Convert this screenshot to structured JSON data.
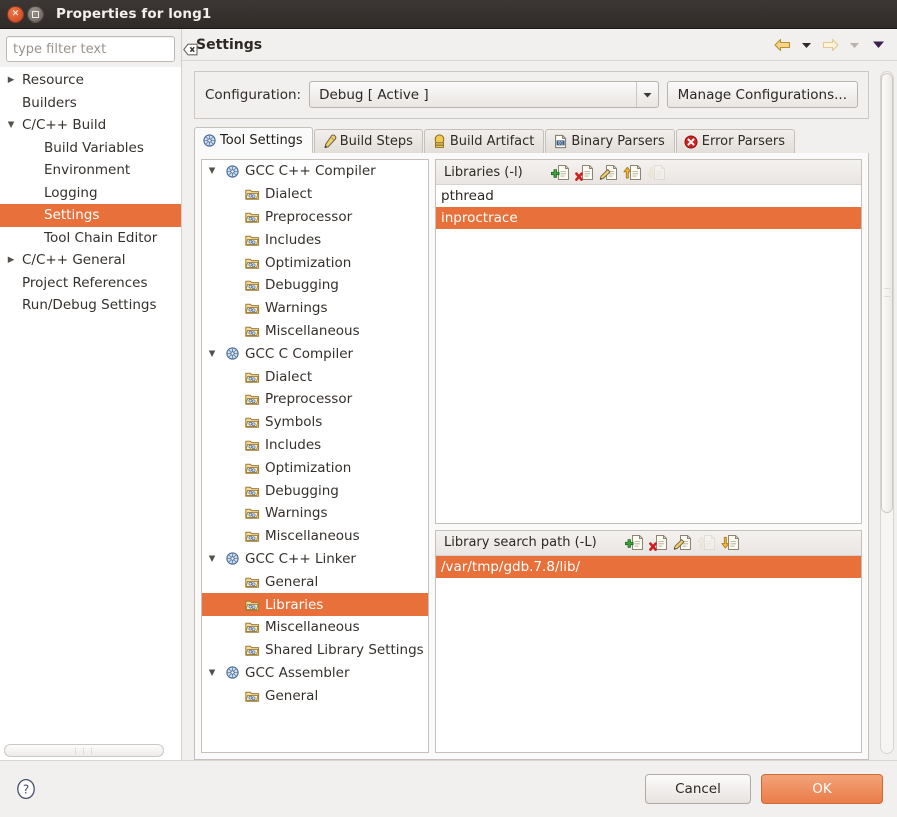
{
  "window": {
    "title": "Properties for long1",
    "close_icon": "close-icon",
    "maximize_icon": "maximize-icon"
  },
  "sidebar": {
    "filter": {
      "placeholder": "type filter text",
      "value": "",
      "clear_icon": "clear-icon"
    },
    "items": [
      {
        "label": "Resource",
        "level": 0,
        "twisty": "collapsed",
        "selected": false
      },
      {
        "label": "Builders",
        "level": 0,
        "twisty": "none",
        "selected": false
      },
      {
        "label": "C/C++ Build",
        "level": 0,
        "twisty": "expanded",
        "selected": false
      },
      {
        "label": "Build Variables",
        "level": 1,
        "twisty": "none",
        "selected": false
      },
      {
        "label": "Environment",
        "level": 1,
        "twisty": "none",
        "selected": false
      },
      {
        "label": "Logging",
        "level": 1,
        "twisty": "none",
        "selected": false
      },
      {
        "label": "Settings",
        "level": 1,
        "twisty": "none",
        "selected": true
      },
      {
        "label": "Tool Chain Editor",
        "level": 1,
        "twisty": "none",
        "selected": false
      },
      {
        "label": "C/C++ General",
        "level": 0,
        "twisty": "collapsed",
        "selected": false
      },
      {
        "label": "Project References",
        "level": 0,
        "twisty": "none",
        "selected": false
      },
      {
        "label": "Run/Debug Settings",
        "level": 0,
        "twisty": "none",
        "selected": false
      }
    ]
  },
  "pane": {
    "title": "Settings",
    "nav": [
      {
        "name": "back-arrow-icon",
        "enabled": true
      },
      {
        "name": "back-dropdown-icon",
        "enabled": true
      },
      {
        "name": "forward-arrow-icon",
        "enabled": false
      },
      {
        "name": "forward-dropdown-icon",
        "enabled": false
      },
      {
        "name": "view-menu-dropdown-icon",
        "enabled": true
      }
    ]
  },
  "configuration": {
    "label": "Configuration:",
    "value": "Debug  [ Active ]",
    "dropdown_icon": "chevron-down-icon",
    "manage_button": "Manage Configurations..."
  },
  "tabs": [
    {
      "label": "Tool Settings",
      "icon": "tool-settings-icon",
      "active": true
    },
    {
      "label": "Build Steps",
      "icon": "build-steps-icon",
      "active": false
    },
    {
      "label": "Build Artifact",
      "icon": "build-artifact-icon",
      "active": false
    },
    {
      "label": "Binary Parsers",
      "icon": "binary-parsers-icon",
      "active": false
    },
    {
      "label": "Error Parsers",
      "icon": "error-parsers-icon",
      "active": false
    }
  ],
  "tool_tree": [
    {
      "label": "GCC C++ Compiler",
      "level": 0,
      "twisty": "expanded",
      "icon": "tool-icon",
      "selected": false
    },
    {
      "label": "Dialect",
      "level": 1,
      "twisty": "none",
      "icon": "folder-icon",
      "selected": false
    },
    {
      "label": "Preprocessor",
      "level": 1,
      "twisty": "none",
      "icon": "folder-icon",
      "selected": false
    },
    {
      "label": "Includes",
      "level": 1,
      "twisty": "none",
      "icon": "folder-icon",
      "selected": false
    },
    {
      "label": "Optimization",
      "level": 1,
      "twisty": "none",
      "icon": "folder-icon",
      "selected": false
    },
    {
      "label": "Debugging",
      "level": 1,
      "twisty": "none",
      "icon": "folder-icon",
      "selected": false
    },
    {
      "label": "Warnings",
      "level": 1,
      "twisty": "none",
      "icon": "folder-icon",
      "selected": false
    },
    {
      "label": "Miscellaneous",
      "level": 1,
      "twisty": "none",
      "icon": "folder-icon",
      "selected": false
    },
    {
      "label": "GCC C Compiler",
      "level": 0,
      "twisty": "expanded",
      "icon": "tool-icon",
      "selected": false
    },
    {
      "label": "Dialect",
      "level": 1,
      "twisty": "none",
      "icon": "folder-icon",
      "selected": false
    },
    {
      "label": "Preprocessor",
      "level": 1,
      "twisty": "none",
      "icon": "folder-icon",
      "selected": false
    },
    {
      "label": "Symbols",
      "level": 1,
      "twisty": "none",
      "icon": "folder-icon",
      "selected": false
    },
    {
      "label": "Includes",
      "level": 1,
      "twisty": "none",
      "icon": "folder-icon",
      "selected": false
    },
    {
      "label": "Optimization",
      "level": 1,
      "twisty": "none",
      "icon": "folder-icon",
      "selected": false
    },
    {
      "label": "Debugging",
      "level": 1,
      "twisty": "none",
      "icon": "folder-icon",
      "selected": false
    },
    {
      "label": "Warnings",
      "level": 1,
      "twisty": "none",
      "icon": "folder-icon",
      "selected": false
    },
    {
      "label": "Miscellaneous",
      "level": 1,
      "twisty": "none",
      "icon": "folder-icon",
      "selected": false
    },
    {
      "label": "GCC C++ Linker",
      "level": 0,
      "twisty": "expanded",
      "icon": "tool-icon",
      "selected": false
    },
    {
      "label": "General",
      "level": 1,
      "twisty": "none",
      "icon": "folder-icon",
      "selected": false
    },
    {
      "label": "Libraries",
      "level": 1,
      "twisty": "none",
      "icon": "folder-icon",
      "selected": true
    },
    {
      "label": "Miscellaneous",
      "level": 1,
      "twisty": "none",
      "icon": "folder-icon",
      "selected": false
    },
    {
      "label": "Shared Library Settings",
      "level": 1,
      "twisty": "none",
      "icon": "folder-icon",
      "selected": false
    },
    {
      "label": "GCC Assembler",
      "level": 0,
      "twisty": "expanded",
      "icon": "tool-icon",
      "selected": false
    },
    {
      "label": "General",
      "level": 1,
      "twisty": "none",
      "icon": "folder-icon",
      "selected": false
    }
  ],
  "libraries_panel": {
    "title": "Libraries (-l)",
    "toolbar": [
      {
        "name": "add-icon",
        "enabled": true
      },
      {
        "name": "delete-icon",
        "enabled": true
      },
      {
        "name": "edit-icon",
        "enabled": true
      },
      {
        "name": "move-up-icon",
        "enabled": true
      },
      {
        "name": "move-down-icon",
        "enabled": false
      }
    ],
    "rows": [
      {
        "value": "pthread",
        "selected": false
      },
      {
        "value": "inproctrace",
        "selected": true
      }
    ]
  },
  "search_path_panel": {
    "title": "Library search path (-L)",
    "toolbar": [
      {
        "name": "add-icon",
        "enabled": true
      },
      {
        "name": "delete-icon",
        "enabled": true
      },
      {
        "name": "edit-icon",
        "enabled": true
      },
      {
        "name": "move-up-icon",
        "enabled": false
      },
      {
        "name": "move-down-icon",
        "enabled": true
      }
    ],
    "rows": [
      {
        "value": "/var/tmp/gdb.7.8/lib/",
        "selected": true
      }
    ]
  },
  "footer": {
    "help_icon": "help-icon",
    "cancel_label": "Cancel",
    "ok_label": "OK"
  },
  "colors": {
    "selection_orange": "#e8703a",
    "titlebar_dark": "#36312e",
    "panel_bg": "#f2f0ef",
    "ok_button": "#ea7c49"
  }
}
